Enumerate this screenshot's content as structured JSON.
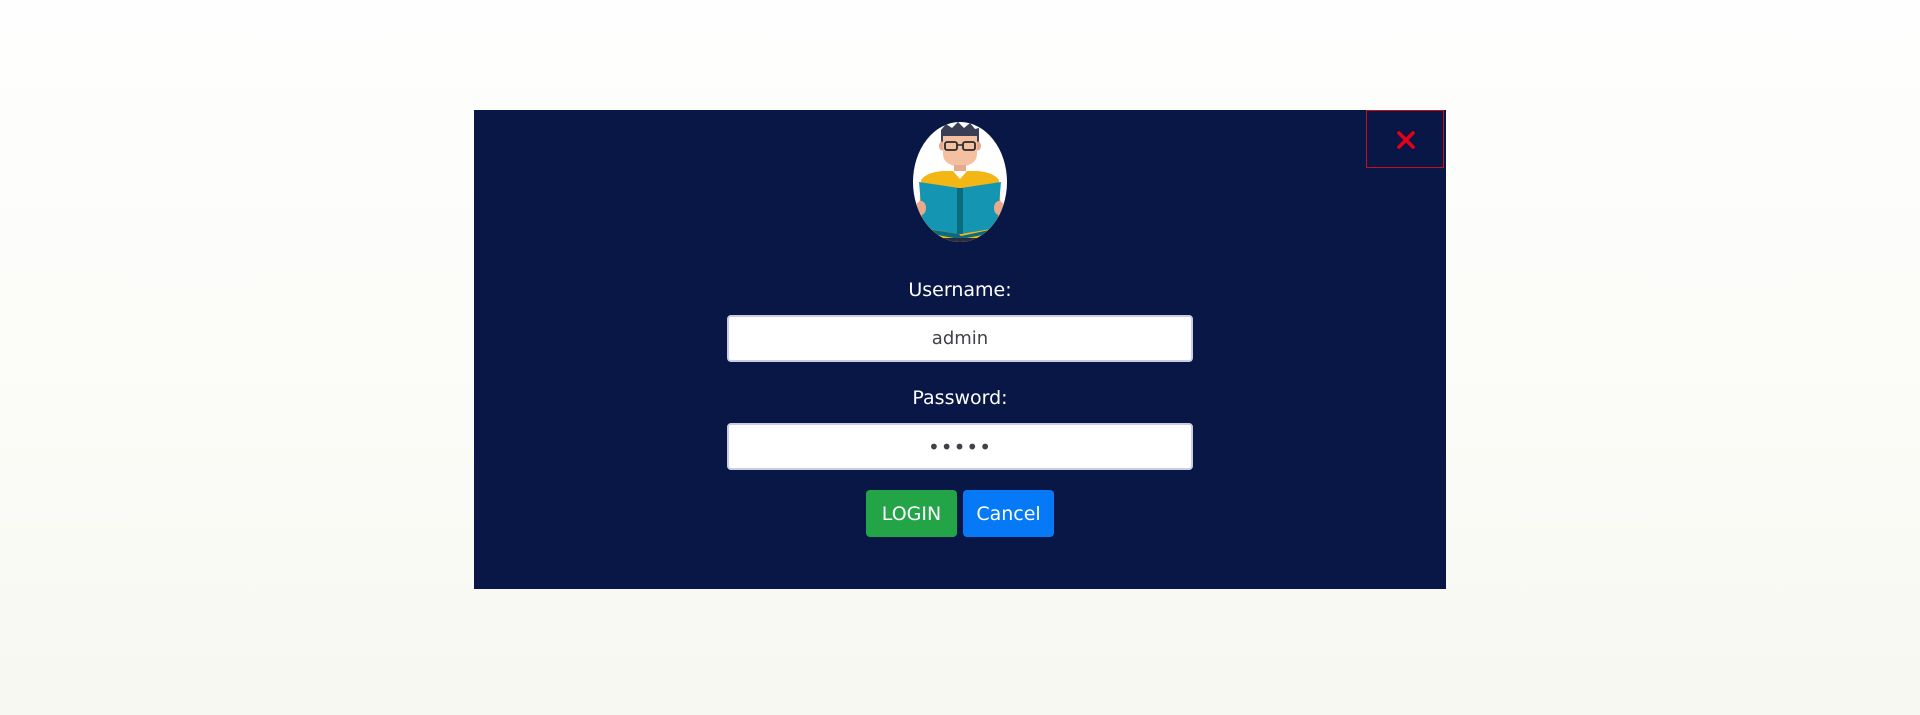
{
  "login_modal": {
    "username_label": "Username:",
    "username_value": "admin",
    "password_label": "Password:",
    "password_value": "admin",
    "login_button": "LOGIN",
    "cancel_button": "Cancel"
  },
  "icons": {
    "close": "close-icon",
    "avatar": "reader-avatar"
  },
  "colors": {
    "modal_background": "#081745",
    "login_button": "#23a447",
    "cancel_button": "#067af6",
    "close_icon": "#e5001a"
  }
}
